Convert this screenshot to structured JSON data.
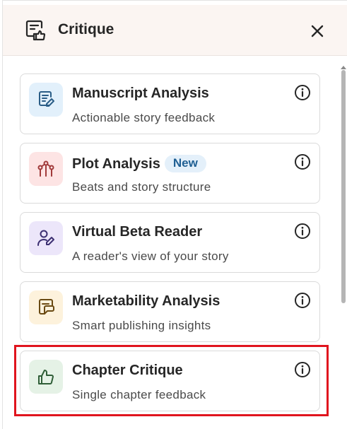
{
  "header": {
    "title": "Critique",
    "icon": "critique-icon",
    "close_icon": "close-icon"
  },
  "cards": [
    {
      "title": "Manuscript Analysis",
      "subtitle": "Actionable story feedback",
      "icon": "document-pen-icon",
      "icon_bg": "#e2f0fb",
      "icon_color": "#2a5d86"
    },
    {
      "title": "Plot Analysis",
      "badge": "New",
      "subtitle": "Beats and story structure",
      "icon": "plot-graph-icon",
      "icon_bg": "#fde4e4",
      "icon_color": "#a13a3a"
    },
    {
      "title": "Virtual Beta Reader",
      "subtitle": "A reader's view of your story",
      "icon": "user-pen-icon",
      "icon_bg": "#ece6fa",
      "icon_color": "#3c2f72"
    },
    {
      "title": "Marketability Analysis",
      "subtitle": "Smart publishing insights",
      "icon": "market-icon",
      "icon_bg": "#fdf2dc",
      "icon_color": "#6a4a12"
    },
    {
      "title": "Chapter Critique",
      "subtitle": "Single chapter feedback",
      "icon": "thumbs-up-icon",
      "icon_bg": "#e5f2e6",
      "icon_color": "#2f5e37"
    }
  ],
  "info_icon": "info-icon",
  "highlight_color": "#e0141e"
}
